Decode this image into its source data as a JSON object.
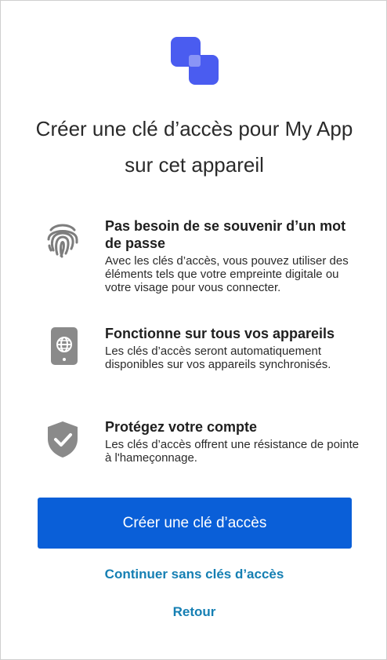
{
  "title": "Créer une clé d’accès pour My App sur cet appareil",
  "features": [
    {
      "icon": "fingerprint-icon",
      "heading": "Pas besoin de se souvenir d’un mot de passe",
      "body": "Avec les clés d’accès, vous pouvez utiliser des éléments tels que votre empreinte digitale ou votre visage pour vous connecter."
    },
    {
      "icon": "device-icon",
      "heading": "Fonctionne sur tous vos appareils",
      "body": "Les clés d’accès seront automatiquement disponibles sur vos appareils synchronisés."
    },
    {
      "icon": "shield-check-icon",
      "heading": "Protégez votre compte",
      "body": "Les clés d’accès offrent une résistance de pointe à l'hameçonnage."
    }
  ],
  "actions": {
    "create_label": "Créer une clé d’accès",
    "continue_label": "Continuer sans clés d’accès",
    "back_label": "Retour"
  },
  "colors": {
    "primary": "#0a5fd8",
    "link": "#157fb3",
    "logo_primary": "#4a5cf0",
    "logo_secondary": "#7f89f5",
    "icon_gray": "#8a8a8a"
  }
}
